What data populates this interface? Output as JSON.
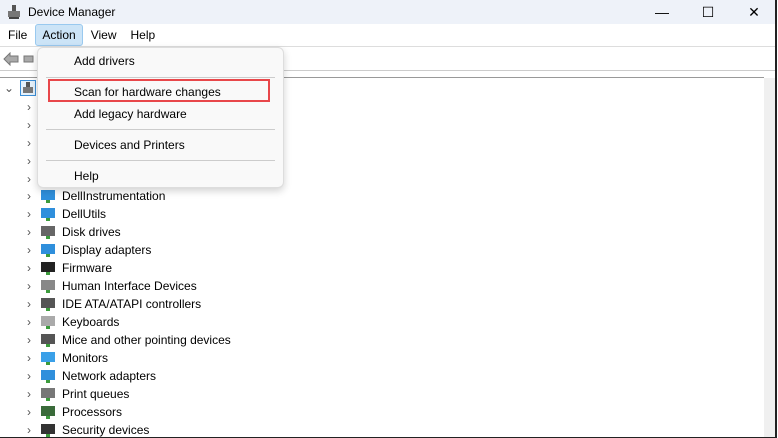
{
  "window": {
    "title": "Device Manager",
    "minimize": "—",
    "maximize": "☐",
    "close": "✕"
  },
  "menubar": [
    "File",
    "Action",
    "View",
    "Help"
  ],
  "action_menu": {
    "items": [
      "Add drivers",
      "Scan for hardware changes",
      "Add legacy hardware",
      "Devices and Printers",
      "Help"
    ],
    "highlighted": "Scan for hardware changes"
  },
  "tree": {
    "items": [
      {
        "label": "DellInstrumentation",
        "icon": "network-icon"
      },
      {
        "label": "DellUtils",
        "icon": "network-icon"
      },
      {
        "label": "Disk drives",
        "icon": "disk-icon"
      },
      {
        "label": "Display adapters",
        "icon": "display-adapter-icon"
      },
      {
        "label": "Firmware",
        "icon": "chip-icon"
      },
      {
        "label": "Human Interface Devices",
        "icon": "hid-icon"
      },
      {
        "label": "IDE ATA/ATAPI controllers",
        "icon": "controller-icon"
      },
      {
        "label": "Keyboards",
        "icon": "keyboard-icon"
      },
      {
        "label": "Mice and other pointing devices",
        "icon": "mouse-icon"
      },
      {
        "label": "Monitors",
        "icon": "monitor-icon"
      },
      {
        "label": "Network adapters",
        "icon": "network-icon"
      },
      {
        "label": "Print queues",
        "icon": "printer-icon"
      },
      {
        "label": "Processors",
        "icon": "processor-icon"
      },
      {
        "label": "Security devices",
        "icon": "security-icon"
      }
    ]
  }
}
